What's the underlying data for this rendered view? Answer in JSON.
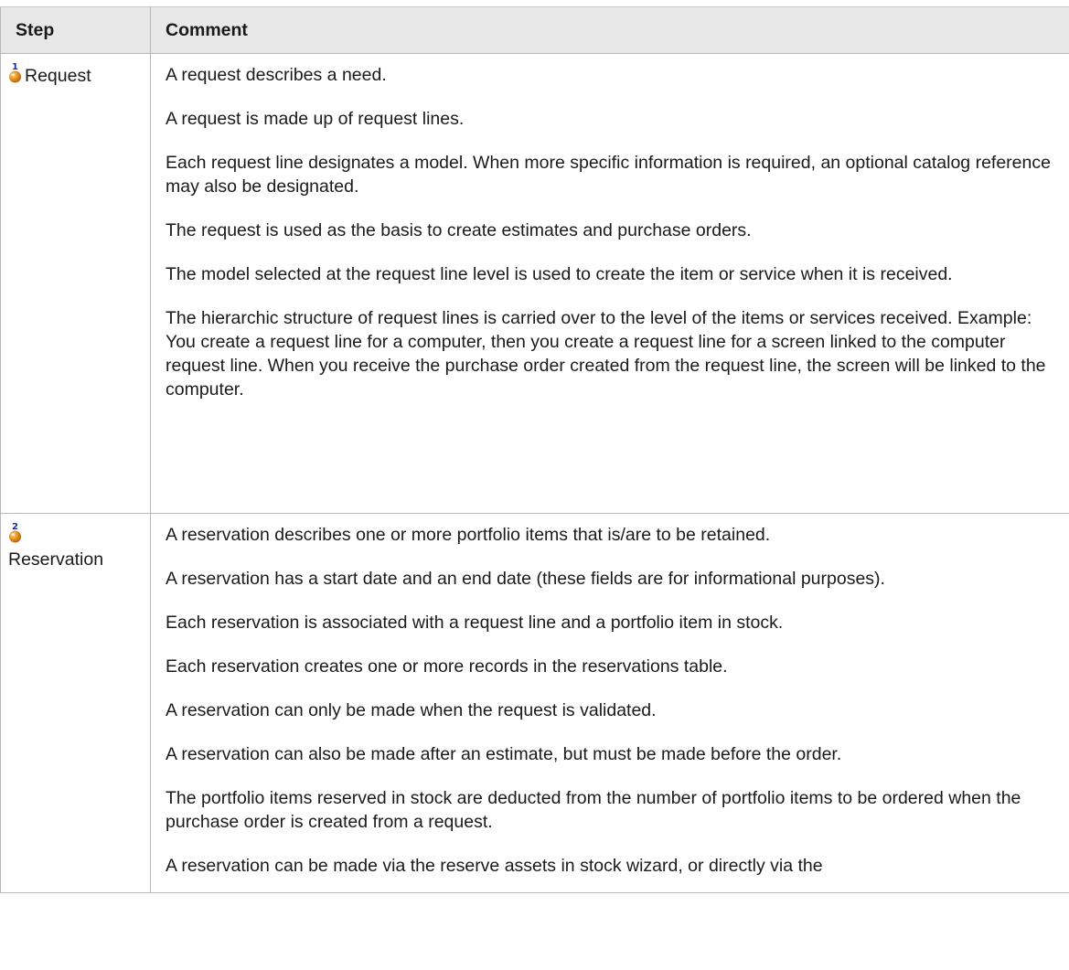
{
  "table": {
    "header": {
      "step": "Step",
      "comment": "Comment"
    },
    "rows": [
      {
        "step_number": "1",
        "step_label": "Request",
        "icon": "step-marker-1-icon",
        "paragraphs": [
          "A request describes a need.",
          "A request is made up of request lines.",
          "Each request line designates a model. When more specific information is required, an optional catalog reference may also be designated.",
          "The request is used as the basis to create estimates and purchase orders.",
          "The model selected at the request line level is used to create the item or service when it is received.",
          "The hierarchic structure of request lines is carried over to the level of the items or services received. Example: You create a request line for a computer, then you create a request line for a screen linked to the computer request line. When you receive the purchase order created from the request line, the screen will be linked to the computer."
        ]
      },
      {
        "step_number": "2",
        "step_label": "Reservation",
        "icon": "step-marker-2-icon",
        "paragraphs": [
          "A reservation describes one or more portfolio items that is/are to be retained.",
          "A reservation has a start date and an end date (these fields are for informational purposes).",
          "Each reservation is associated with a request line and a portfolio item in stock.",
          "Each reservation creates one or more records in the reservations table.",
          "A reservation can only be made when the request is validated.",
          "A reservation can also be made after an estimate, but must be made before the order.",
          "The portfolio items reserved in stock are deducted from the number of portfolio items to be ordered when the purchase order is created from a request.",
          "A reservation can be made via the reserve assets in stock wizard, or directly via the"
        ]
      }
    ]
  },
  "colors": {
    "header_bg": "#e8e8e8",
    "border": "#b8b8b8",
    "icon_orange": "#e08a1e",
    "icon_number": "#1d2f8a"
  }
}
